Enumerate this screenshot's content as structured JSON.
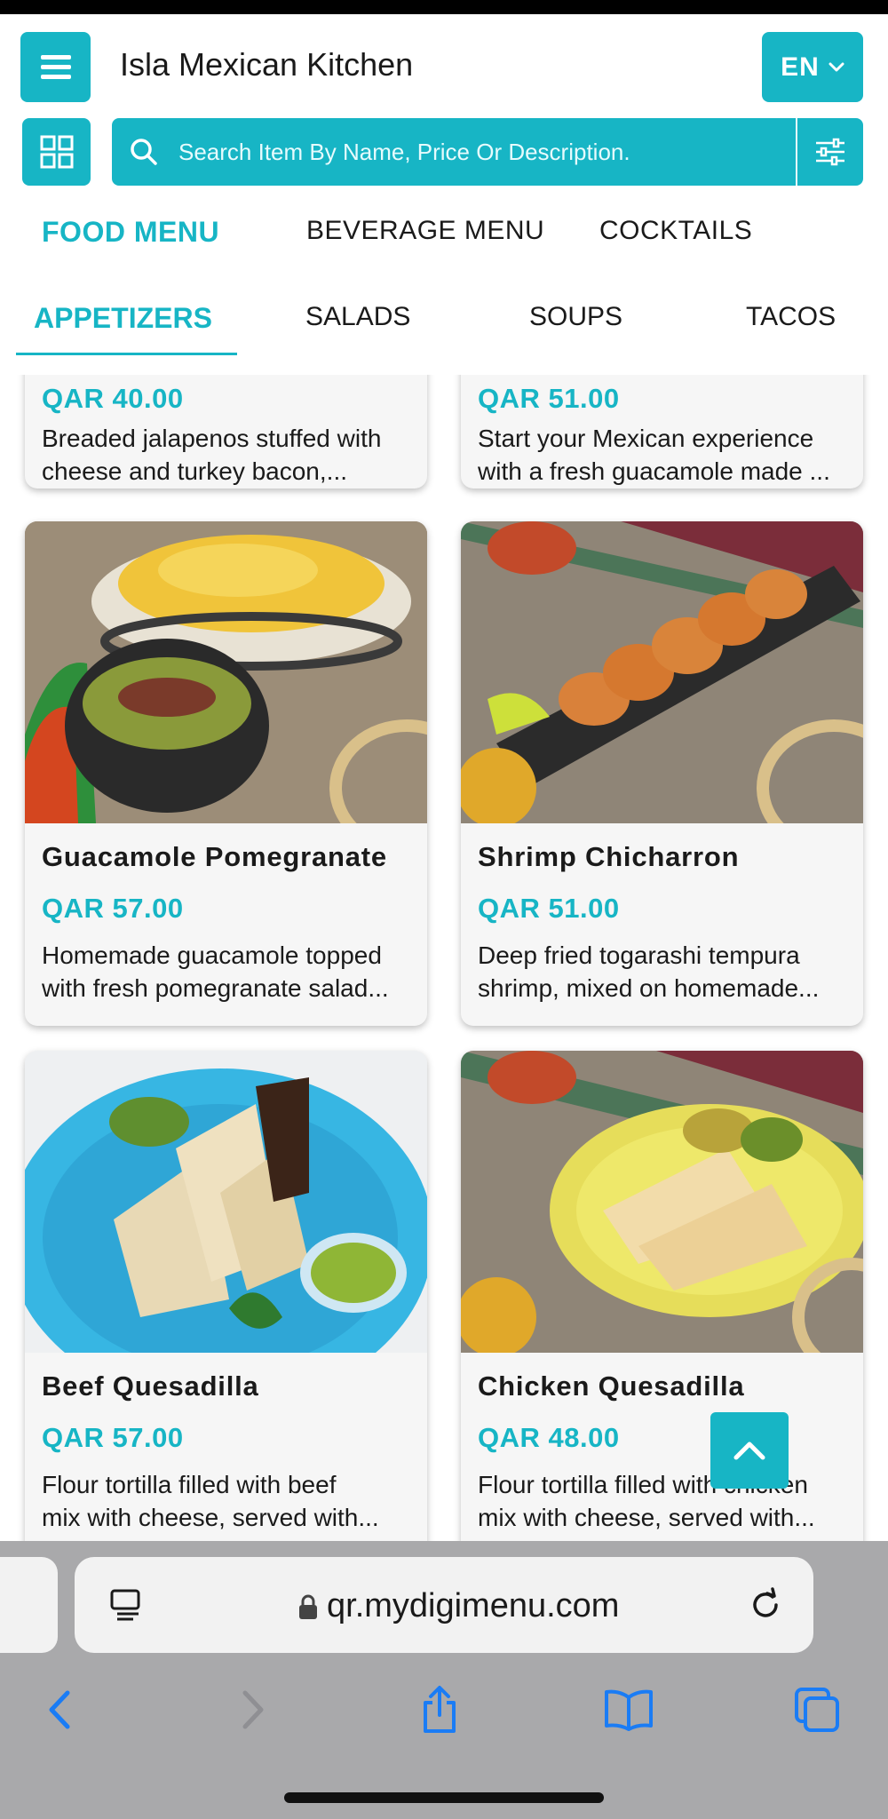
{
  "header": {
    "title": "Isla Mexican Kitchen",
    "language": "EN"
  },
  "search": {
    "placeholder": "Search Item By Name, Price Or Description."
  },
  "menu_tabs": [
    {
      "label": "FOOD MENU",
      "active": true
    },
    {
      "label": "BEVERAGE MENU",
      "active": false
    },
    {
      "label": "COCKTAILS",
      "active": false
    }
  ],
  "category_tabs": [
    {
      "label": "APPETIZERS",
      "active": true
    },
    {
      "label": "SALADS",
      "active": false
    },
    {
      "label": "SOUPS",
      "active": false
    },
    {
      "label": "TACOS",
      "active": false
    }
  ],
  "items": [
    {
      "name": "",
      "price": "QAR 40.00",
      "desc": [
        "Breaded jalapenos stuffed with",
        "cheese and turkey bacon,..."
      ]
    },
    {
      "name": "",
      "price": "QAR 51.00",
      "desc": [
        "Start your Mexican experience",
        "with a fresh guacamole made ..."
      ]
    },
    {
      "name": "Guacamole Pomegranate",
      "price": "QAR 57.00",
      "desc": [
        "Homemade guacamole topped",
        "with fresh pomegranate salad..."
      ]
    },
    {
      "name": "Shrimp Chicharron",
      "price": "QAR 51.00",
      "desc": [
        "Deep fried togarashi tempura",
        "shrimp, mixed on homemade..."
      ]
    },
    {
      "name": "Beef Quesadilla",
      "price": "QAR 57.00",
      "desc": [
        "Flour tortilla filled with beef",
        "mix with cheese, served with..."
      ]
    },
    {
      "name": "Chicken Quesadilla",
      "price": "QAR 48.00",
      "desc": [
        "Flour tortilla filled with chicken",
        "mix with cheese, served with..."
      ]
    }
  ],
  "browser": {
    "url": "qr.mydigimenu.com"
  },
  "colors": {
    "accent": "#17b5c5",
    "ios_blue": "#1a7cf5"
  }
}
